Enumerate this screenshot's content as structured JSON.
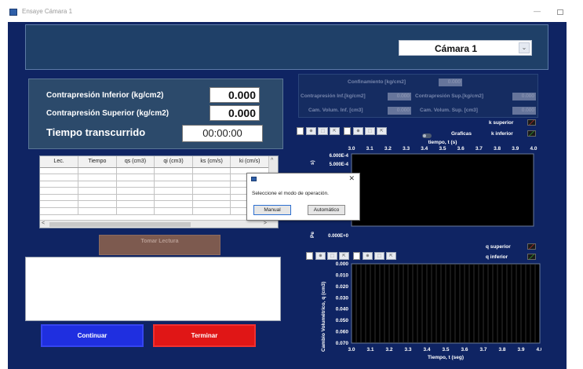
{
  "window": {
    "title": "Ensaye Cámara 1",
    "minimize_glyph": "—"
  },
  "header": {
    "camera_selected": "Cámara 1",
    "dropdown_glyph": "⌄"
  },
  "pressures": {
    "inferior_label": "Contrapresión Inferior (kg/cm2)",
    "inferior_value": "0.000",
    "superior_label": "Contrapresión Superior (kg/cm2)",
    "superior_value": "0.000",
    "time_label": "Tiempo transcurrido",
    "time_value": "00:00:00"
  },
  "confinement": {
    "confinamiento_label": "Confinamiento [kg/cm2]",
    "confinamiento_value": "0.000",
    "contra_inf_label": "Contrapresión Inf.[kg/cm2]",
    "contra_inf_value": "0.000",
    "contra_sup_label": "Contrapresión Sup.[kg/cm2]",
    "contra_sup_value": "0.000",
    "cam_vol_inf_label": "Cam. Volum. Inf. [cm3]",
    "cam_vol_inf_value": "0.000",
    "cam_vol_sup_label": "Cam. Volum. Sup. [cm3]",
    "cam_vol_sup_value": "0.000"
  },
  "table": {
    "columns": [
      "Lec.",
      "Tiempo",
      "qs (cm3)",
      "qi (cm3)",
      "ks (cm/s)",
      "ki (cm/s)"
    ],
    "empty_rows": 7,
    "scroll_up_glyph": "^",
    "scroll_left_glyph": "<",
    "scroll_right_glyph": ">"
  },
  "buttons": {
    "tomar_lectura": "Tomar Lectura",
    "continuar": "Continuar",
    "terminar": "Terminar"
  },
  "toolbar_glyphs": [
    "⊕",
    "⬚",
    "⇱",
    "⊕",
    "⬚",
    "⇱"
  ],
  "graph1": {
    "toggle_label": "Graficas",
    "legend": [
      "k superior",
      "k inferior"
    ],
    "x_title": "tiempo, t (s)",
    "y_title_fragment": "Pe",
    "y_title_end": "s)",
    "x_ticks": [
      "3.0",
      "3.1",
      "3.2",
      "3.3",
      "3.4",
      "3.5",
      "3.6",
      "3.7",
      "3.8",
      "3.9",
      "4.0"
    ],
    "y_ticks": [
      "6.000E-4",
      "5.000E-4",
      "1.000E-4",
      "0.000E+0"
    ]
  },
  "graph2": {
    "legend": [
      "q superior",
      "q inferior"
    ],
    "x_title": "Tiempo, t (seg)",
    "y_title": "Cambio Volumétrico, q (cm3)",
    "x_ticks": [
      "3.0",
      "3.1",
      "3.2",
      "3.3",
      "3.4",
      "3.5",
      "3.6",
      "3.7",
      "3.8",
      "3.9",
      "4.0"
    ],
    "y_ticks": [
      "0.000",
      "0.010",
      "0.020",
      "0.030",
      "0.040",
      "0.050",
      "0.060",
      "0.070"
    ]
  },
  "dialog": {
    "close_glyph": "✕",
    "message": "Seleccione el modo de operación.",
    "manual": "Manual",
    "automatico": "Automático"
  },
  "colors": {
    "app_bg": "#0f2463",
    "legend_k_superior": "#e03030",
    "legend_k_inferior": "#30c030",
    "legend_q_superior": "#e03030",
    "legend_q_inferior": "#30c030"
  }
}
